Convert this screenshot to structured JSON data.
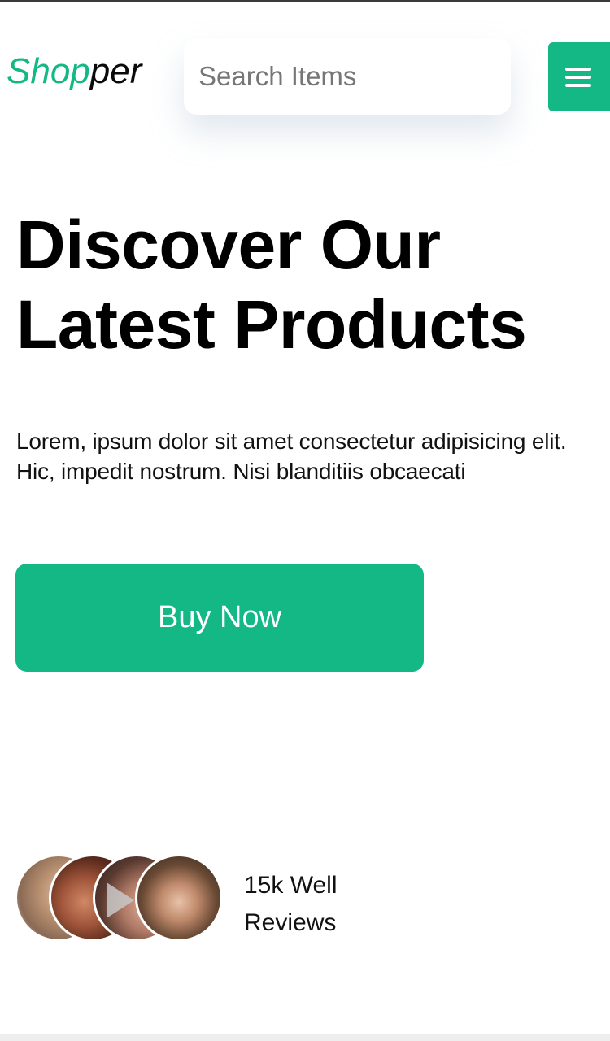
{
  "header": {
    "logo_accent": "Shop",
    "logo_rest": "per",
    "search_placeholder": "Search Items",
    "menu_icon": "hamburger-menu-icon"
  },
  "hero": {
    "title_line1": "Discover Our",
    "title_line2": "Latest Products",
    "description": "Lorem, ipsum dolor sit amet consectetur adipisicing elit. Hic, impedit nostrum. Nisi blanditiis obcaecati",
    "button_label": "Buy Now"
  },
  "reviews": {
    "line1": "15k Well",
    "line2": "Reviews",
    "avatars": [
      "avatar-1",
      "avatar-2",
      "avatar-3",
      "avatar-4"
    ]
  },
  "colors": {
    "accent": "#14b884",
    "text": "#000000",
    "background": "#ffffff"
  }
}
